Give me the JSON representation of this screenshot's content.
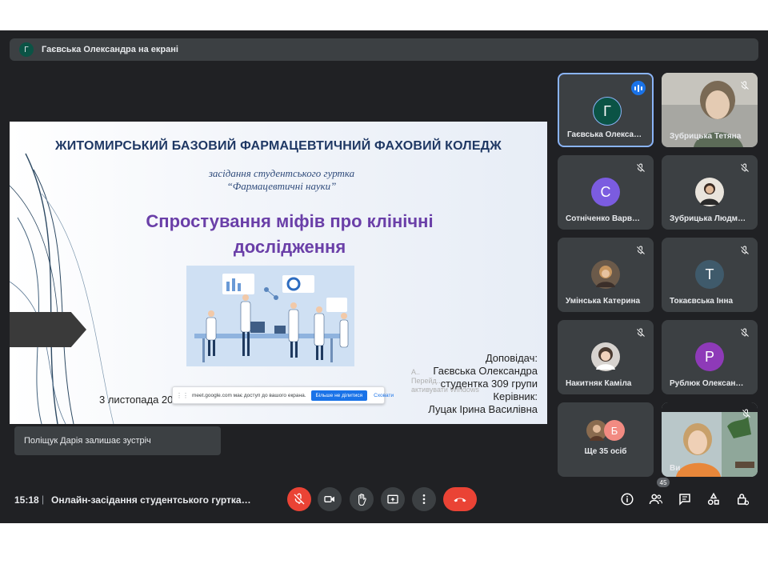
{
  "header": {
    "presenter_initial": "Г",
    "presenting_text": "Гаєвська Олександра на екрані"
  },
  "slide": {
    "college": "ЖИТОМИРСЬКИЙ БАЗОВИЙ ФАРМАЦЕВТИЧНИЙ ФАХОВИЙ КОЛЕДЖ",
    "subtitle1": "засідання студентського гуртка",
    "subtitle2": "“Фармацевтичні науки”",
    "title_line1": "Спростування міфів про клінічні",
    "title_line2": "дослідження",
    "speaker": {
      "line1": "Доповідач:",
      "line2": "Гаєвська Олександра",
      "line3": "студентка 309 групи",
      "line4": "Керівник:",
      "line5": "Луцак Ірина Василівна"
    },
    "date": "3 листопада 2022",
    "share_bar": {
      "message": "meet.google.com має доступ до вашого екрана.",
      "stop_label": "Більше не ділитися",
      "hide_label": "Сховати"
    }
  },
  "toast": "Поліщук Дарія залишає зустріч",
  "participants": [
    {
      "initial": "Г",
      "name": "Гаєвська Олекса…",
      "color": "#0b5345",
      "speaking": true
    },
    {
      "initial": "",
      "name": "Зубрицька Тетяна",
      "photo": true
    },
    {
      "initial": "С",
      "name": "Сотніченко Варв…",
      "color": "#7b5ce0"
    },
    {
      "initial": "",
      "name": "Зубрицька Людм…",
      "photo": true
    },
    {
      "initial": "",
      "name": "Умінська Катерина",
      "photo": true
    },
    {
      "initial": "Т",
      "name": "Токаєвська Інна",
      "color": "#3f5a6b"
    },
    {
      "initial": "",
      "name": "Накитняк Каміла",
      "photo": true
    },
    {
      "initial": "Р",
      "name": "Рублюк Олексан…",
      "color": "#8e3ab8"
    },
    {
      "more_initial": "Б",
      "name": "Ще 35 осіб"
    },
    {
      "name": "Ви",
      "self": true
    }
  ],
  "bottombar": {
    "time": "15:18",
    "separator": "|",
    "meeting_title": "Онлайн-засідання студентського гуртка…",
    "people_count": "45",
    "controls": [
      "mic-off-icon",
      "camera-icon",
      "raise-hand-icon",
      "present-icon",
      "more-options-icon",
      "hangup-icon"
    ],
    "right_icons": [
      "info-icon",
      "people-icon",
      "chat-icon",
      "activities-icon",
      "host-controls-icon"
    ]
  }
}
